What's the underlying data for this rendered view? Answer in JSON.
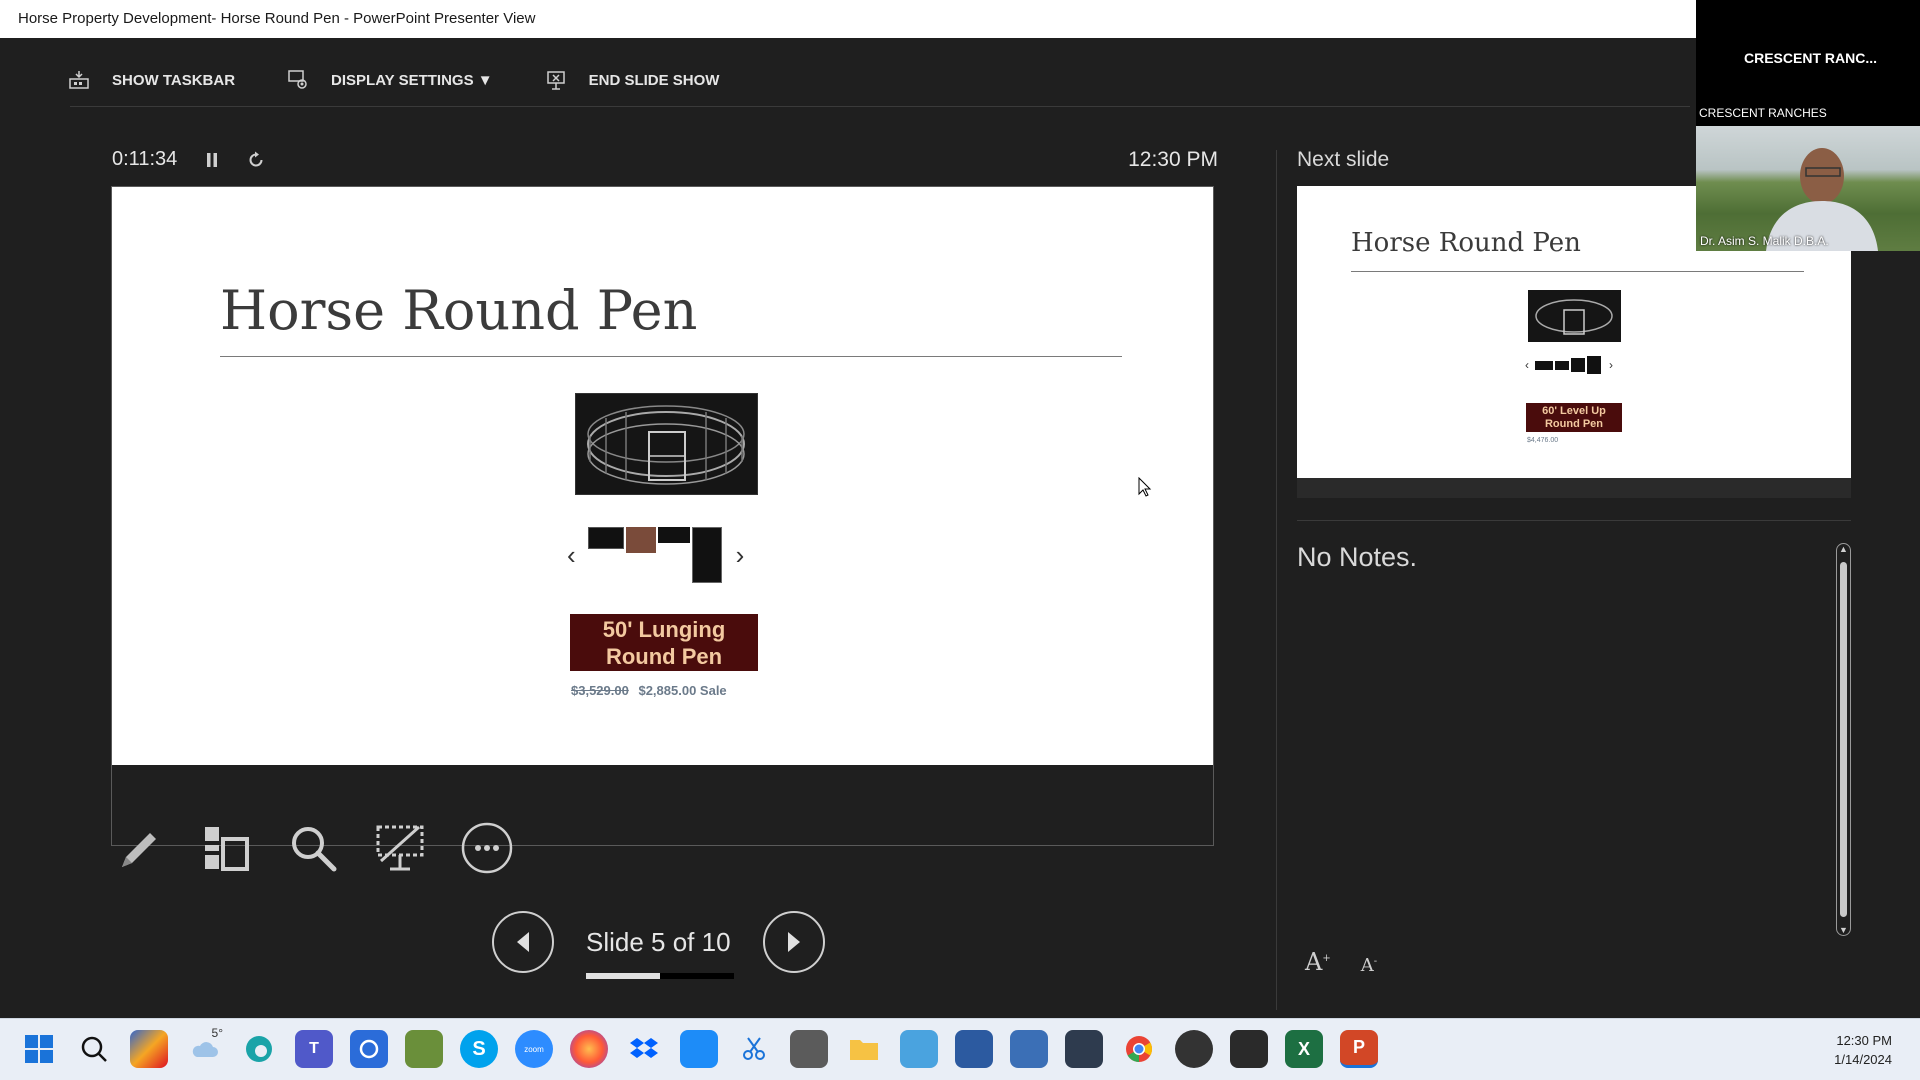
{
  "window": {
    "title": "Horse Property Development- Horse Round Pen - PowerPoint Presenter View"
  },
  "toolbar": {
    "show_taskbar": "SHOW TASKBAR",
    "display_settings": "DISPLAY SETTINGS ▼",
    "end_slide_show": "END SLIDE SHOW"
  },
  "timer": {
    "elapsed": "0:11:34",
    "clock": "12:30 PM"
  },
  "current_slide": {
    "title": "Horse Round Pen",
    "badge_line1": "50' Lunging",
    "badge_line2": "Round Pen",
    "old_price": "$3,529.00",
    "new_price": "$2,885.00 Sale"
  },
  "navigation": {
    "slide_count": "Slide 5 of 10",
    "current": 5,
    "total": 10
  },
  "next_slide": {
    "label": "Next slide",
    "title": "Horse Round Pen",
    "badge_line1": "60' Level Up",
    "badge_line2": "Round Pen",
    "price": "$4,476.00"
  },
  "notes": {
    "text": "No Notes."
  },
  "meeting": {
    "name": "CRESCENT  RANC...",
    "participant_label": "CRESCENT RANCHES",
    "video_name": "Dr. Asim S. Malik D.B.A."
  },
  "taskbar": {
    "time": "12:30 PM",
    "date": "1/14/2024",
    "weather": "5°"
  },
  "icons": [
    "presenter-icon",
    "display-settings-icon",
    "end-show-icon",
    "pause-icon",
    "restart-icon",
    "pen-icon",
    "see-all-slides-icon",
    "zoom-icon",
    "black-screen-icon",
    "more-options-icon",
    "previous-icon",
    "next-icon"
  ]
}
